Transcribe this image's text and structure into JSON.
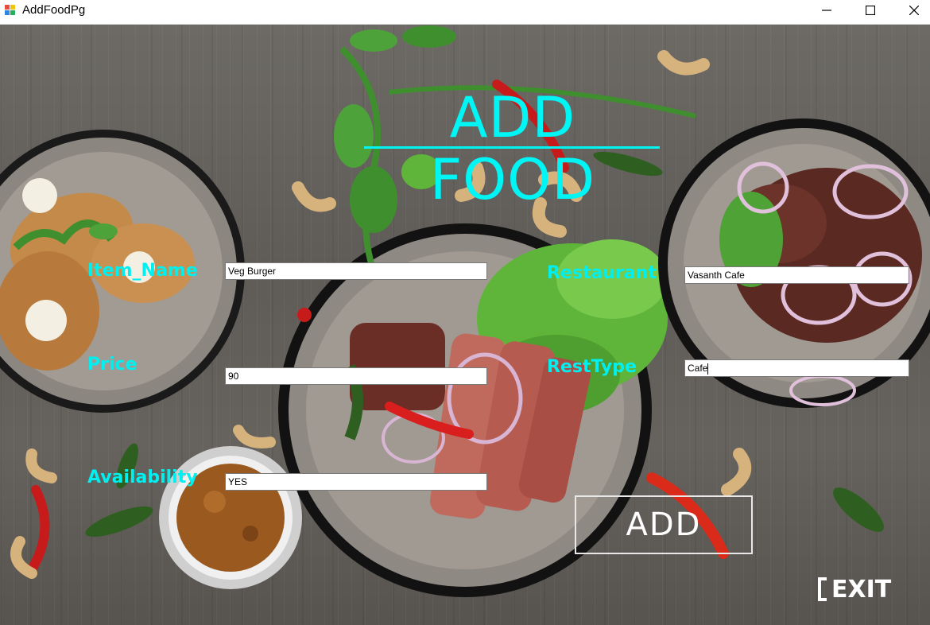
{
  "window": {
    "title": "AddFoodPg",
    "minimize_glyph": "—",
    "maximize_glyph": "☐",
    "close_glyph": "✕"
  },
  "page": {
    "title": "ADD FOOD"
  },
  "form": {
    "item_name": {
      "label": "Item_Name",
      "value": "Veg Burger"
    },
    "price": {
      "label": "Price",
      "value": "90"
    },
    "availability": {
      "label": "Availability",
      "value": "YES"
    },
    "restaurant": {
      "label": "Restaurant",
      "value": "Vasanth Cafe"
    },
    "rest_type": {
      "label": "RestType",
      "value": "Cafe"
    }
  },
  "actions": {
    "add_label": "ADD",
    "exit_label": "EXIT"
  },
  "icons": {
    "app": "app-icon",
    "minimize": "minimize-icon",
    "maximize": "maximize-icon",
    "close": "close-icon",
    "exit": "exit-door-icon"
  },
  "colors": {
    "label_cyan": "#00f0f0",
    "title_cyan": "#00f5f5",
    "button_text": "#ffffff",
    "background_wood": "#66625d"
  }
}
